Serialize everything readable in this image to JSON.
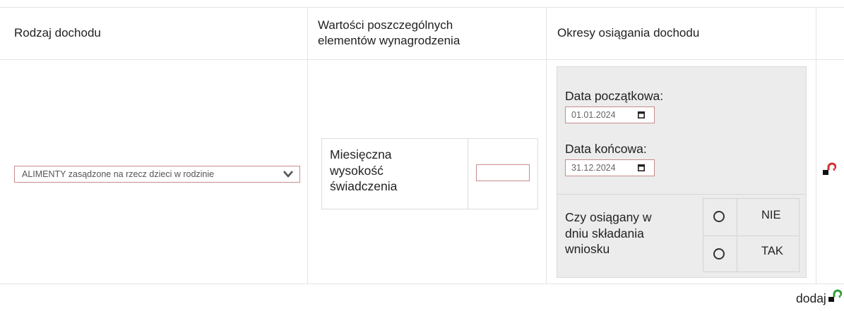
{
  "table": {
    "headers": {
      "type": "Rodzaj dochodu",
      "values_line1": "Wartości poszczególnych",
      "values_line2": "elementów wynagrodzenia",
      "periods": "Okresy osiągania dochodu"
    }
  },
  "row": {
    "income_type": {
      "selected": "ALIMENTY zasądzone na rzecz dzieci w rodzinie"
    },
    "values": {
      "label_line1": "Miesięczna",
      "label_line2": "wysokość",
      "label_line3": "świadczenia",
      "amount": ""
    },
    "period": {
      "start_label": "Data początkowa:",
      "start_value": "01.01.2024",
      "end_label": "Data końcowa:",
      "end_value": "31.12.2024",
      "question_line1": "Czy osiągany w",
      "question_line2": "dniu składania",
      "question_line3": "wniosku",
      "options": [
        "NIE",
        "TAK"
      ]
    }
  },
  "actions": {
    "add_label": "dodaj"
  },
  "colors": {
    "border_invalid": "#c98c8c",
    "panel_bg": "#ececec",
    "remove_icon": "#d32f2f",
    "add_icon": "#2e9d36"
  }
}
